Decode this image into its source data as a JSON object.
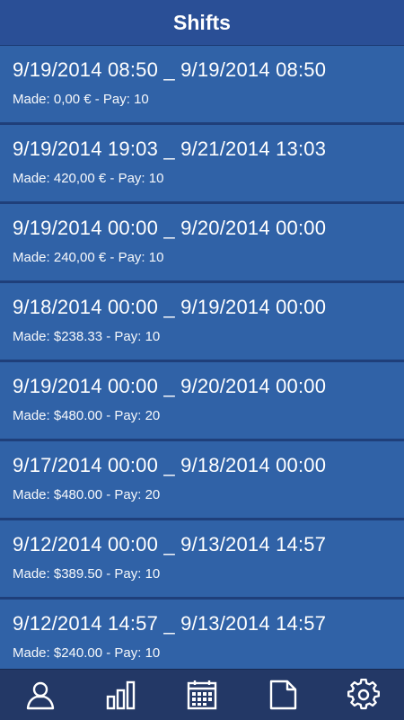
{
  "header": {
    "title": "Shifts"
  },
  "shifts": [
    {
      "range": "9/19/2014 08:50 _ 9/19/2014 08:50",
      "made": "Made: 0,00 € - Pay: 10"
    },
    {
      "range": "9/19/2014 19:03 _ 9/21/2014 13:03",
      "made": "Made: 420,00 € - Pay: 10"
    },
    {
      "range": "9/19/2014 00:00 _ 9/20/2014 00:00",
      "made": "Made: 240,00 € - Pay: 10"
    },
    {
      "range": "9/18/2014 00:00 _ 9/19/2014 00:00",
      "made": "Made: $238.33 - Pay: 10"
    },
    {
      "range": "9/19/2014 00:00 _ 9/20/2014 00:00",
      "made": "Made: $480.00 - Pay: 20"
    },
    {
      "range": "9/17/2014 00:00 _ 9/18/2014 00:00",
      "made": "Made: $480.00 - Pay: 20"
    },
    {
      "range": "9/12/2014 00:00 _ 9/13/2014 14:57",
      "made": "Made: $389.50 - Pay: 10"
    },
    {
      "range": "9/12/2014 14:57 _ 9/13/2014 14:57",
      "made": "Made: $240.00 - Pay: 10"
    }
  ],
  "bottom_nav": [
    {
      "icon": "user-icon"
    },
    {
      "icon": "bar-chart-icon"
    },
    {
      "icon": "calendar-icon"
    },
    {
      "icon": "document-icon"
    },
    {
      "icon": "settings-gear-icon"
    }
  ],
  "colors": {
    "header_bg": "#2a4f96",
    "item_bg": "#3062a7",
    "separator": "#1f3f7a",
    "nav_bg": "#233866",
    "text": "#ffffff"
  }
}
